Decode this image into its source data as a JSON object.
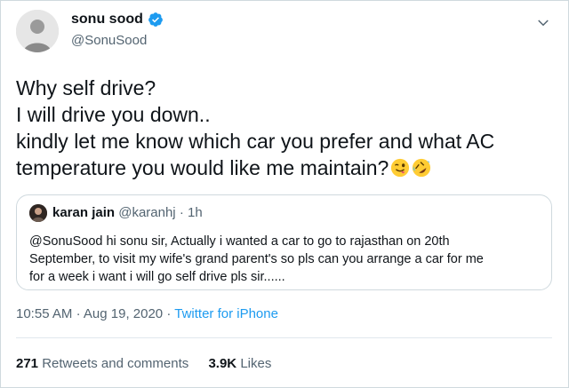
{
  "author": {
    "display_name": "sonu sood",
    "handle": "@SonuSood",
    "verified": true
  },
  "tweet": {
    "lines": [
      "Why self drive?",
      "I will drive you down..",
      "kindly let me know which car you prefer and what AC",
      "temperature you would like me maintain?"
    ],
    "emojis": [
      "winking-face-with-tongue",
      "rolling-on-floor-laughing"
    ]
  },
  "quoted_tweet": {
    "name": "karan jain",
    "handle": "@karanhj",
    "separator": "·",
    "age": "1h",
    "lines": [
      "@SonuSood hi sonu sir, Actually i wanted a car to go to rajasthan on 20th",
      "September, to visit my wife's grand parent's so pls can you arrange a car for me",
      "for a week i want i will go self drive pls sir......"
    ]
  },
  "meta": {
    "time": "10:55 AM",
    "separator": "·",
    "date": "Aug 19, 2020",
    "app": "Twitter for iPhone"
  },
  "stats": {
    "retweets_count": "271",
    "retweets_label": "Retweets and comments",
    "likes_count": "3.9K",
    "likes_label": "Likes"
  },
  "colors": {
    "accent": "#1d9bf0",
    "text": "#0f1419",
    "secondary": "#536471",
    "border": "#cfd9de"
  }
}
